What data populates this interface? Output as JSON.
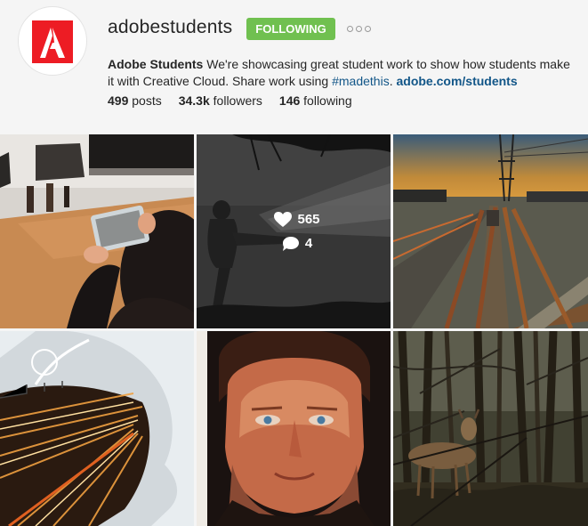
{
  "profile": {
    "username": "adobestudents",
    "follow_label": "FOLLOWING",
    "more_icon": "more-options-icon",
    "bio_name": "Adobe Students",
    "bio_text": " We're showcasing great student work to show how students make it with Creative Cloud. Share work using ",
    "bio_hashtag": "#madethis",
    "bio_sep": ". ",
    "bio_link": "adobe.com/students",
    "avatar_icon": "adobe-logo-icon",
    "colors": {
      "follow": "#70c050",
      "link": "#125688",
      "adobe_red": "#ed1c24"
    }
  },
  "stats": {
    "posts_count": "499",
    "posts_label": "posts",
    "followers_count": "34.3k",
    "followers_label": "followers",
    "following_count": "146",
    "following_label": "following"
  },
  "posts": [
    {
      "name": "tablet-figurines-photo"
    },
    {
      "name": "double-exposure-kick-photo",
      "likes": "565",
      "comments": "4",
      "like_icon": "heart-icon",
      "comment_icon": "comment-bubble-icon"
    },
    {
      "name": "railway-tracks-photo"
    },
    {
      "name": "profile-highway-lights-photo"
    },
    {
      "name": "portrait-painting-photo"
    },
    {
      "name": "deer-in-woods-photo"
    }
  ]
}
